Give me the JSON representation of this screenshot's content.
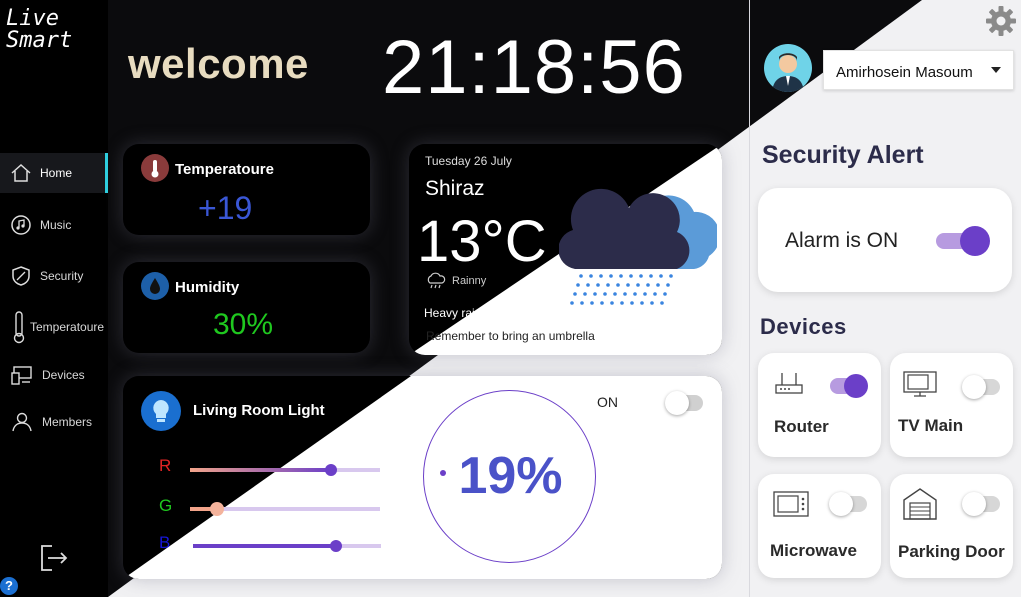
{
  "app": {
    "logo": [
      "Live",
      "Smart"
    ],
    "welcome": "welcome",
    "clock": "21:18:56"
  },
  "sidebar": {
    "items": [
      {
        "label": "Home",
        "icon": "home-icon",
        "active": true
      },
      {
        "label": "Music",
        "icon": "music-icon"
      },
      {
        "label": "Security",
        "icon": "shield-icon"
      },
      {
        "label": "Temperatoure",
        "icon": "thermometer-icon"
      },
      {
        "label": "Devices",
        "icon": "devices-icon"
      },
      {
        "label": "Members",
        "icon": "members-icon"
      }
    ]
  },
  "sensors": {
    "temperature": {
      "title": "Temperatoure",
      "value": "+19"
    },
    "humidity": {
      "title": "Humidity",
      "value": "30%"
    }
  },
  "weather": {
    "date": "Tuesday 26 July",
    "city": "Shiraz",
    "temp": "13°C",
    "condition": "Rainny",
    "note1": "Heavy rain!",
    "note2": "Remember to bring an umbrella"
  },
  "light": {
    "title": "Living Room Light",
    "state_label": "ON",
    "brightness": "19%",
    "channels": [
      {
        "label": "R",
        "color": "#e02424",
        "level": 0.74
      },
      {
        "label": "G",
        "color": "#1fc81f",
        "level": 0.14
      },
      {
        "label": "B",
        "color": "#1616d8",
        "level": 0.76
      }
    ]
  },
  "user": {
    "name": "Amirhosein Masoum"
  },
  "security": {
    "title": "Security Alert",
    "alarm_label": "Alarm is ON",
    "alarm_on": true
  },
  "devices": {
    "title": "Devices",
    "items": [
      {
        "label": "Router",
        "icon": "router-icon",
        "on": true
      },
      {
        "label": "TV Main",
        "icon": "tv-icon",
        "on": false
      },
      {
        "label": "Microwave",
        "icon": "microwave-icon",
        "on": false
      },
      {
        "label": "Parking Door",
        "icon": "garage-door-icon",
        "on": false
      }
    ]
  },
  "colors": {
    "accent": "#6b3fc8",
    "active_nav": "#2fd0e0",
    "temperature_value": "#3a57d6",
    "humidity_value": "#1fc81f",
    "brightness": "#4a52c8"
  }
}
